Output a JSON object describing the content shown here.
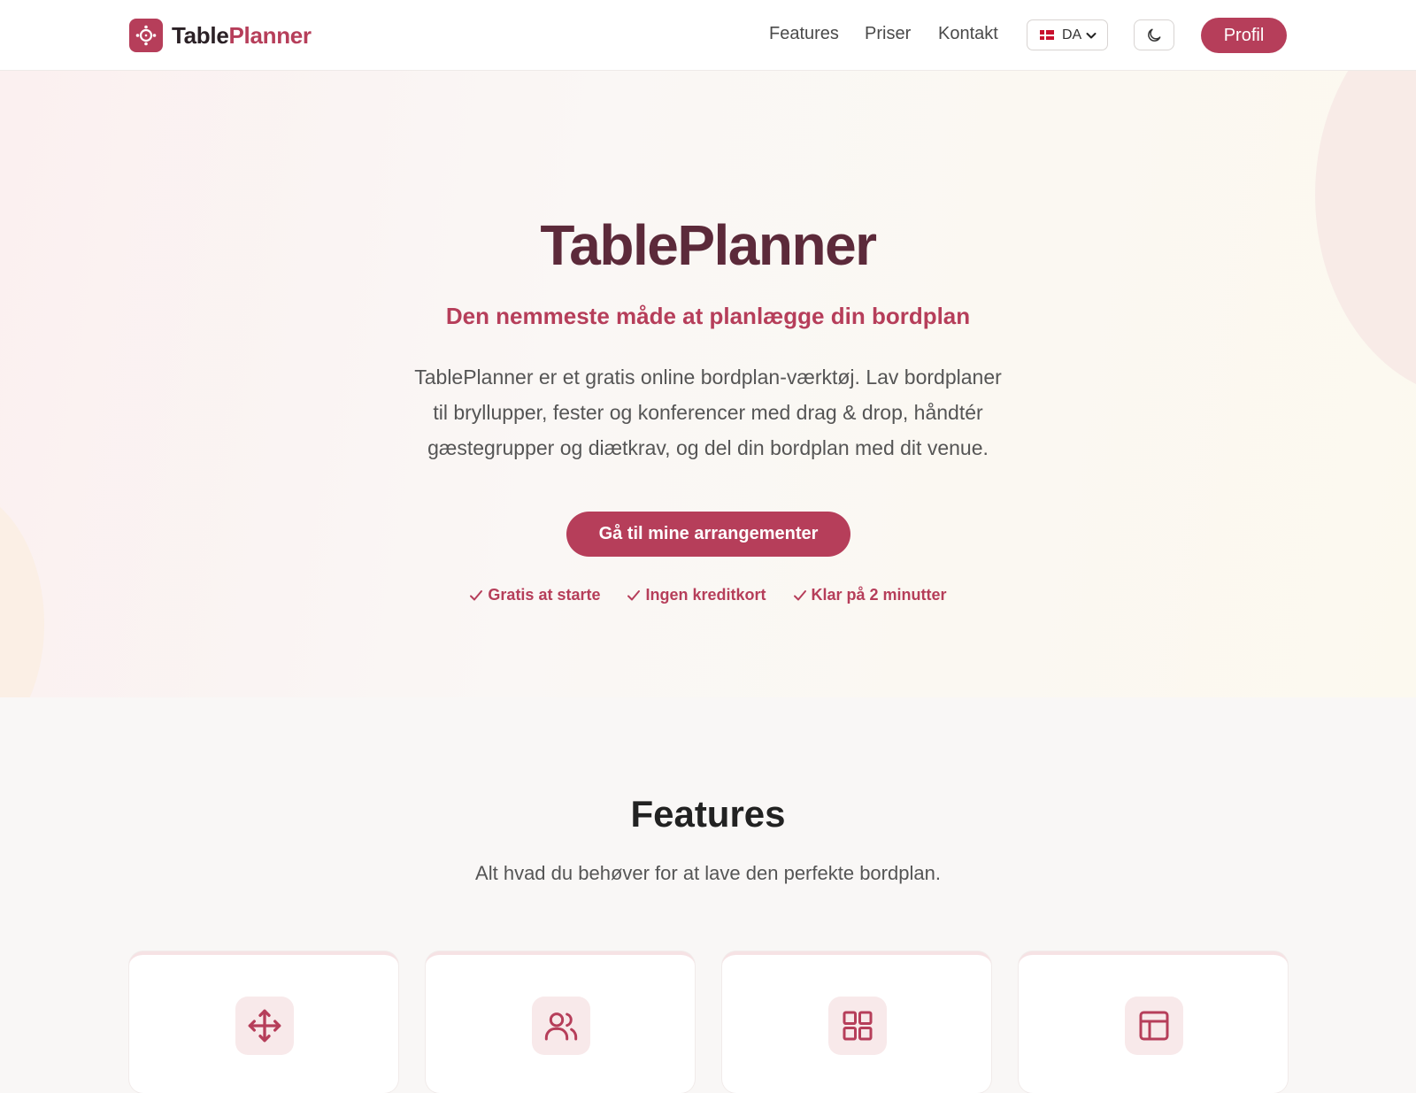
{
  "brand": {
    "part1": "Table",
    "part2": "Planner"
  },
  "nav": {
    "links": [
      "Features",
      "Priser",
      "Kontakt"
    ],
    "language": "DA",
    "profile_label": "Profil"
  },
  "hero": {
    "title": "TablePlanner",
    "subtitle": "Den nemmeste måde at planlægge din bordplan",
    "description": "TablePlanner er et gratis online bordplan-værktøj. Lav bordplaner til bryllupper, fester og konferencer med drag & drop, håndtér gæstegrupper og diætkrav, og del din bordplan med dit venue.",
    "cta_label": "Gå til mine arrangementer",
    "perks": [
      "Gratis at starte",
      "Ingen kreditkort",
      "Klar på 2 minutter"
    ]
  },
  "features": {
    "title": "Features",
    "subtitle": "Alt hvad du behøver for at lave den perfekte bordplan.",
    "cards": [
      {
        "icon": "move-icon"
      },
      {
        "icon": "users-icon"
      },
      {
        "icon": "grid-icon"
      },
      {
        "icon": "layout-icon"
      }
    ]
  },
  "colors": {
    "accent": "#b63e5a",
    "title_dark": "#5c2a3a",
    "icon_bg": "#f8e9ea"
  }
}
